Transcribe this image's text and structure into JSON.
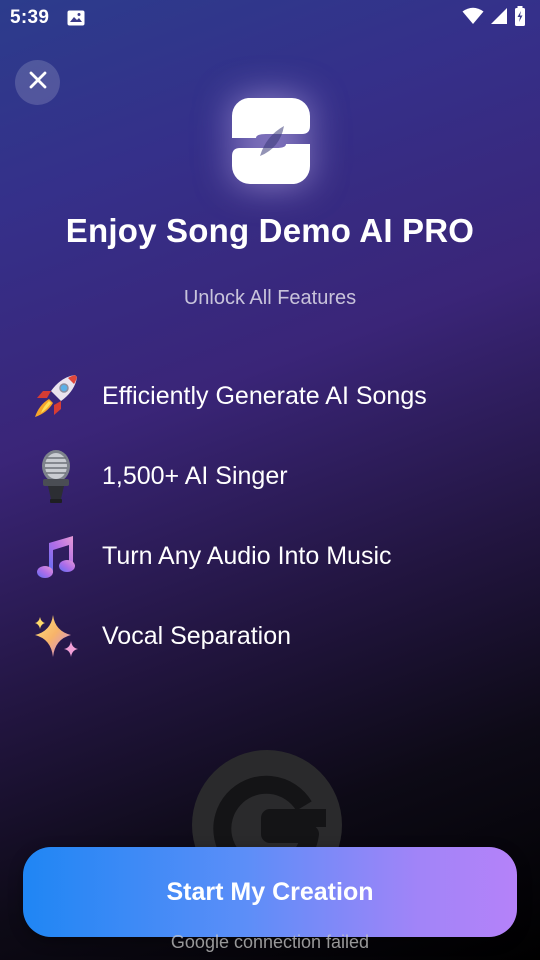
{
  "status_bar": {
    "time": "5:39",
    "icons": [
      "image-icon",
      "wifi-icon",
      "signal-icon",
      "battery-charging-icon"
    ]
  },
  "close_icon": "close-icon",
  "app_logo": "song-demo-logo",
  "title": "Enjoy Song Demo AI PRO",
  "subtitle": "Unlock All Features",
  "features": [
    {
      "icon": "rocket-icon",
      "label": "Efficiently Generate AI Songs"
    },
    {
      "icon": "microphone-icon",
      "label": "1,500+ AI Singer"
    },
    {
      "icon": "music-note-icon",
      "label": "Turn Any Audio Into Music"
    },
    {
      "icon": "sparkles-icon",
      "label": "Vocal Separation"
    }
  ],
  "google_logo": "google-icon",
  "cta_label": "Start My Creation",
  "error_text": "Google connection failed",
  "colors": {
    "cta_start": "#1f86f4",
    "cta_end": "#b582f9"
  }
}
